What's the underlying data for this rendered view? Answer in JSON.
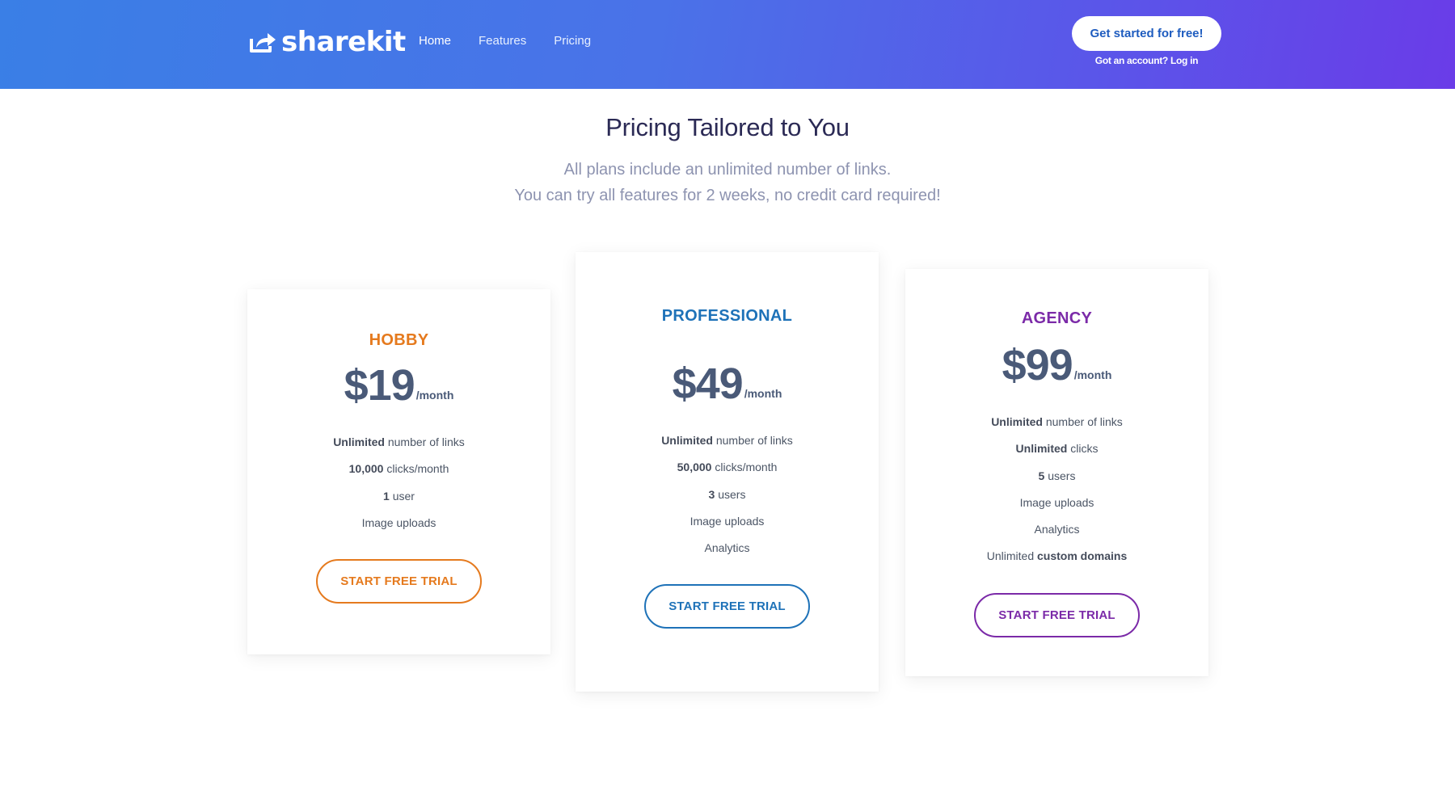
{
  "header": {
    "logo_text": "sharekit",
    "logo_icon": "share-icon",
    "nav": [
      {
        "label": "Home",
        "active": true
      },
      {
        "label": "Features",
        "active": false
      },
      {
        "label": "Pricing",
        "active": false
      }
    ],
    "cta_label": "Get started for free!",
    "login_text": "Got an account? Log in"
  },
  "hero": {
    "title": "Pricing Tailored to You",
    "subtitle_line1": "All plans include an unlimited number of links.",
    "subtitle_line2": "You can try all features for 2 weeks, no credit card required!"
  },
  "plans": [
    {
      "name": "HOBBY",
      "price": "$19",
      "period": "/month",
      "color": "#e57a1e",
      "features": [
        {
          "bold": "Unlimited",
          "text": " number of links"
        },
        {
          "bold": "10,000",
          "text": " clicks/month"
        },
        {
          "bold": "1",
          "text": " user"
        },
        {
          "bold": "",
          "text": "Image uploads"
        }
      ],
      "button_label": "START FREE TRIAL"
    },
    {
      "name": "PROFESSIONAL",
      "price": "$49",
      "period": "/month",
      "color": "#1e72b8",
      "features": [
        {
          "bold": "Unlimited",
          "text": " number of links"
        },
        {
          "bold": "50,000",
          "text": " clicks/month"
        },
        {
          "bold": "3",
          "text": " users"
        },
        {
          "bold": "",
          "text": "Image uploads"
        },
        {
          "bold": "",
          "text": "Analytics"
        }
      ],
      "button_label": "START FREE TRIAL"
    },
    {
      "name": "AGENCY",
      "price": "$99",
      "period": "/month",
      "color": "#7b2aa8",
      "features": [
        {
          "bold": "Unlimited",
          "text": " number of links"
        },
        {
          "bold": "Unlimited",
          "text": " clicks"
        },
        {
          "bold": "5",
          "text": " users"
        },
        {
          "bold": "",
          "text": "Image uploads"
        },
        {
          "bold": "",
          "text": "Analytics"
        },
        {
          "prefix": "Unlimited ",
          "bold": "custom domains",
          "text": ""
        }
      ],
      "button_label": "START FREE TRIAL"
    }
  ]
}
